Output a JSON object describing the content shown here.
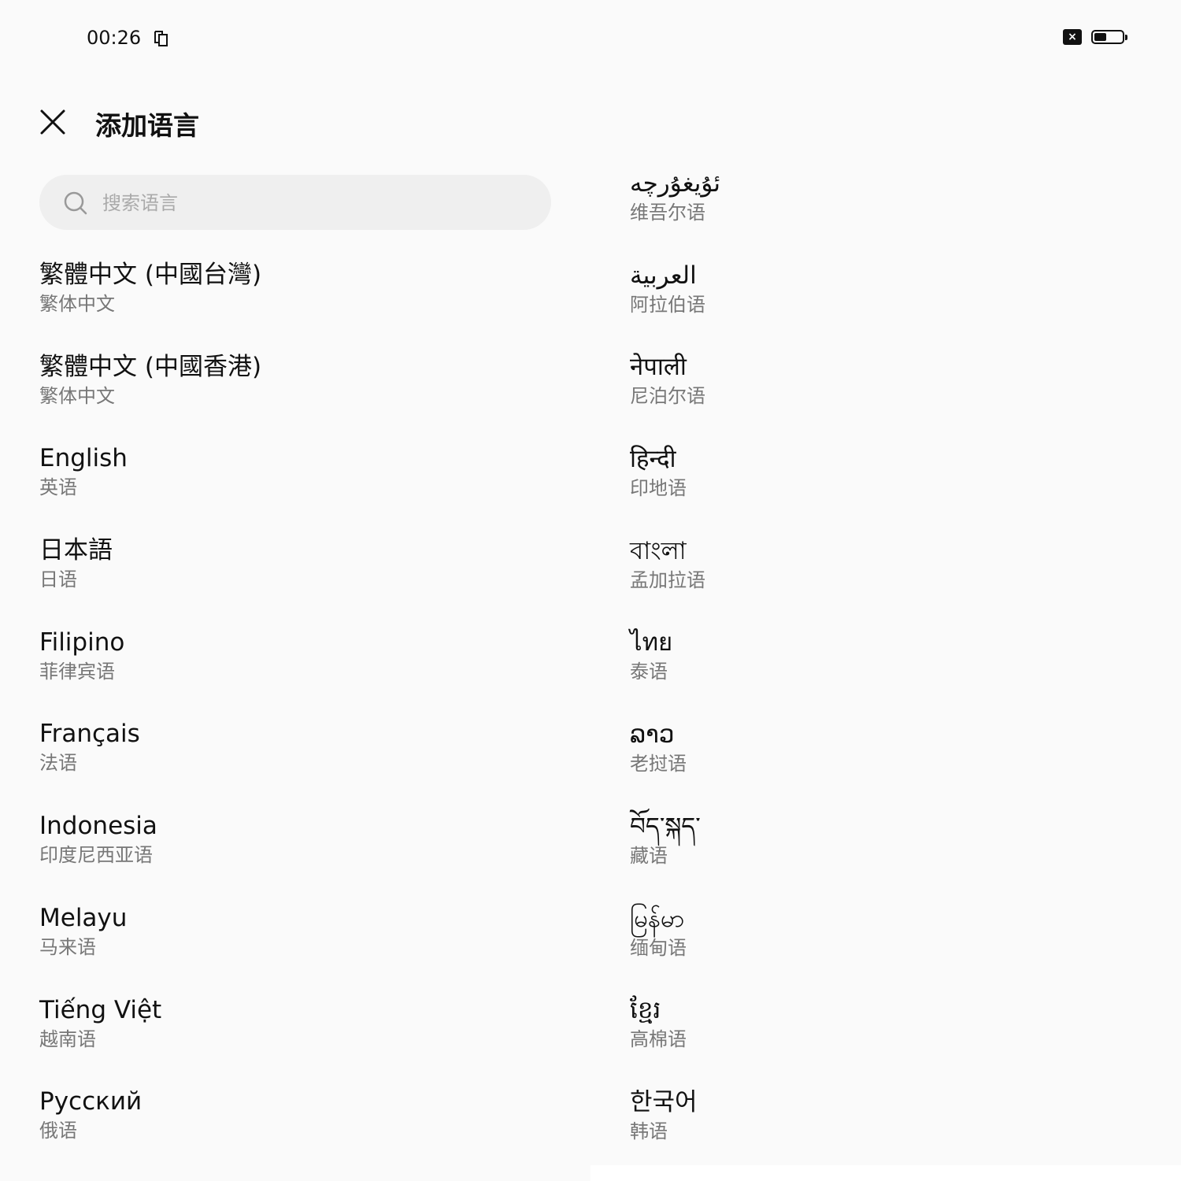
{
  "status_bar": {
    "time": "00:26",
    "icons": [
      "screen-copy-icon",
      "no-sim-icon",
      "battery-icon"
    ],
    "battery_level": 0.35
  },
  "header": {
    "title": "添加语言",
    "close_icon": "close-icon"
  },
  "search": {
    "placeholder": "搜索语言",
    "value": ""
  },
  "left_languages": [
    {
      "name": "繁體中文 (中國台灣)",
      "sub": "繁体中文"
    },
    {
      "name": "繁體中文 (中國香港)",
      "sub": "繁体中文"
    },
    {
      "name": "English",
      "sub": "英语"
    },
    {
      "name": "日本語",
      "sub": "日语"
    },
    {
      "name": "Filipino",
      "sub": "菲律宾语"
    },
    {
      "name": "Français",
      "sub": "法语"
    },
    {
      "name": "Indonesia",
      "sub": "印度尼西亚语"
    },
    {
      "name": "Melayu",
      "sub": "马来语"
    },
    {
      "name": "Tiếng Việt",
      "sub": "越南语"
    },
    {
      "name": "Русский",
      "sub": "俄语"
    }
  ],
  "right_languages": [
    {
      "name": "ئۇيغۇرچە",
      "sub": "维吾尔语"
    },
    {
      "name": "العربية",
      "sub": "阿拉伯语"
    },
    {
      "name": "नेपाली",
      "sub": "尼泊尔语"
    },
    {
      "name": "हिन्दी",
      "sub": "印地语"
    },
    {
      "name": "বাংলা",
      "sub": "孟加拉语"
    },
    {
      "name": "ไทย",
      "sub": "泰语"
    },
    {
      "name": "ລາວ",
      "sub": "老挝语"
    },
    {
      "name": "བོད་སྐད་",
      "sub": "藏语"
    },
    {
      "name": "မြန်မာ",
      "sub": "缅甸语"
    },
    {
      "name": "ខ្មែរ",
      "sub": "高棉语"
    },
    {
      "name": "한국어",
      "sub": "韩语"
    }
  ]
}
